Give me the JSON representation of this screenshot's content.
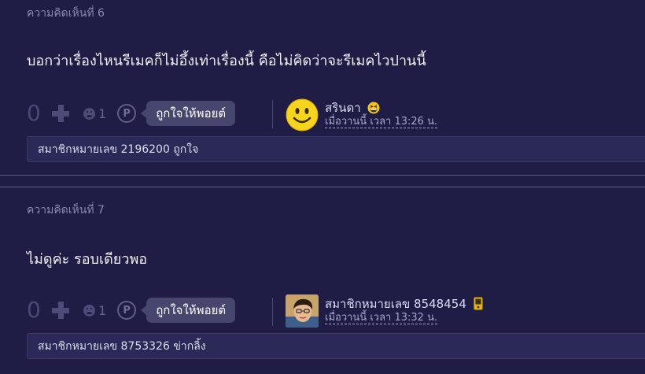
{
  "comments": [
    {
      "title": "ความคิดเห็นที่ 6",
      "body": "บอกว่าเรื่องไหนรีเมคก็ไม่อึ้งเท่าเรื่องนี้ คือไม่คิดว่าจะรีเมคไวปานนี้",
      "vote_count": "0",
      "emotion_count": "1",
      "point_icon": "P",
      "like_button": "ถูกใจให้พอยต์",
      "author_name": "สรินดา",
      "author_time": "เมื่อวานนี้ เวลา 13:26 น.",
      "author_avatar": "smiley-face-icon",
      "author_badge": "laughing-emoji-icon",
      "likers": "สมาชิกหมายเลข 2196200 ถูกใจ"
    },
    {
      "title": "ความคิดเห็นที่ 7",
      "body": "ไม่ดูค่ะ รอบเดียวพอ",
      "vote_count": "0",
      "emotion_count": "1",
      "point_icon": "P",
      "like_button": "ถูกใจให้พอยต์",
      "author_name": "สมาชิกหมายเลข 8548454",
      "author_time": "เมื่อวานนี้ เวลา 13:32 น.",
      "author_avatar": "cartoon-boy-avatar",
      "author_badge": "mobile-phone-icon",
      "likers": "สมาชิกหมายเลข 8753326 ข่ากลิ้ง"
    }
  ],
  "colors": {
    "background": "#1f1d45",
    "like_button": "#47466f",
    "likers_bar": "#2a2957",
    "time_link": "#a7a6d0"
  }
}
